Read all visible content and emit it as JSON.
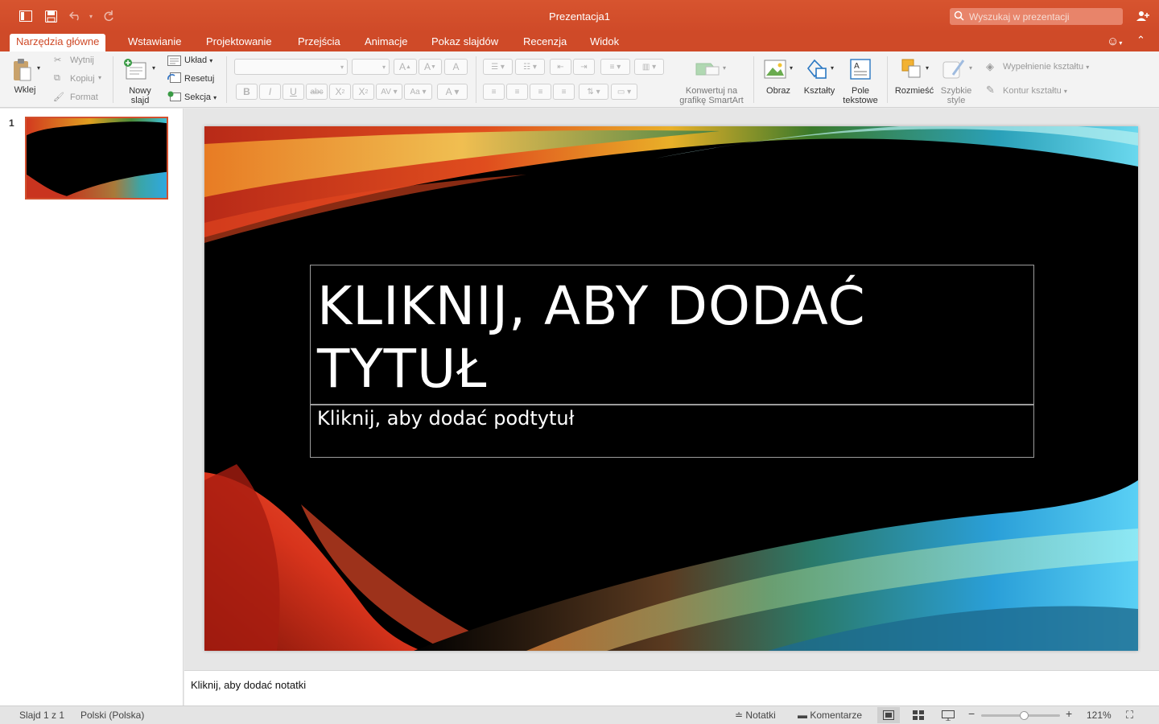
{
  "window": {
    "title": "Prezentacja1"
  },
  "search": {
    "placeholder": "Wyszukaj w prezentacji"
  },
  "tabs": [
    "Narzędzia główne",
    "Wstawianie",
    "Projektowanie",
    "Przejścia",
    "Animacje",
    "Pokaz slajdów",
    "Recenzja",
    "Widok"
  ],
  "ribbon": {
    "paste": "Wklej",
    "cut": "Wytnij",
    "copy": "Kopiuj",
    "format": "Format",
    "new_slide_line1": "Nowy",
    "new_slide_line2": "slajd",
    "layout": "Układ",
    "reset": "Resetuj",
    "section": "Sekcja",
    "smartart_line1": "Konwertuj na",
    "smartart_line2": "grafikę SmartArt",
    "picture": "Obraz",
    "shapes": "Kształty",
    "textbox_line1": "Pole",
    "textbox_line2": "tekstowe",
    "arrange": "Rozmieść",
    "quick_styles_line1": "Szybkie",
    "quick_styles_line2": "style",
    "shape_fill": "Wypełnienie kształtu",
    "shape_outline": "Kontur kształtu"
  },
  "slides_panel": {
    "slide_number": "1"
  },
  "slide": {
    "title": "KLIKNIJ, ABY DODAĆ TYTUŁ",
    "subtitle": "Kliknij, aby dodać podtytuł"
  },
  "notes": {
    "placeholder": "Kliknij, aby dodać notatki"
  },
  "status": {
    "slide_info": "Slajd 1 z 1",
    "language": "Polski (Polska)",
    "notes_btn": "Notatki",
    "comments_btn": "Komentarze",
    "zoom": "121%",
    "zoom_level_fraction": 0.55
  },
  "colors": {
    "accent": "#cf4a28",
    "slide_background": "#000000"
  }
}
